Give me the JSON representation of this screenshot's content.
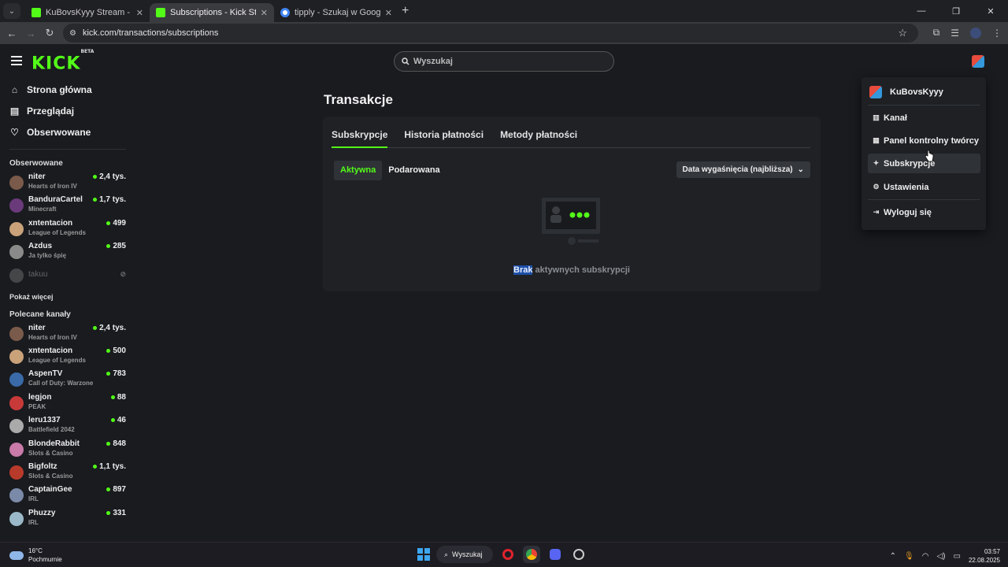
{
  "browser": {
    "tabs": [
      {
        "title": "KuBovsKyyy Stream - Watch Liv",
        "active": false,
        "favicon": "kick"
      },
      {
        "title": "Subscriptions - Kick Streaming",
        "active": true,
        "favicon": "kick"
      },
      {
        "title": "tipply - Szukaj w Google",
        "active": false,
        "favicon": "google"
      }
    ],
    "url": "kick.com/transactions/subscriptions"
  },
  "header": {
    "logo": "KICK",
    "logo_badge": "BETA",
    "search_placeholder": "Wyszukaj"
  },
  "sidebar": {
    "nav": [
      {
        "label": "Strona główna",
        "icon": "home-icon"
      },
      {
        "label": "Przeglądaj",
        "icon": "browse-icon"
      },
      {
        "label": "Obserwowane",
        "icon": "heart-icon"
      }
    ],
    "followed_title": "Obserwowane",
    "followed": [
      {
        "name": "niter",
        "game": "Hearts of Iron IV",
        "viewers": "2,4 tys.",
        "color": "#7a5a4a"
      },
      {
        "name": "BanduraCartel",
        "game": "Minecraft",
        "viewers": "1,7 tys.",
        "color": "#6a3a7a"
      },
      {
        "name": "xntentacion",
        "game": "League of Legends",
        "viewers": "499",
        "color": "#c9a27a"
      },
      {
        "name": "Azdus",
        "game": "Ja tylko śpię",
        "viewers": "285",
        "color": "#8a8a8a"
      }
    ],
    "offline": {
      "name": "takuu"
    },
    "show_more": "Pokaż więcej",
    "recommended_title": "Polecane kanały",
    "recommended": [
      {
        "name": "niter",
        "game": "Hearts of Iron IV",
        "viewers": "2,4 tys.",
        "color": "#7a5a4a"
      },
      {
        "name": "xntentacion",
        "game": "League of Legends",
        "viewers": "500",
        "color": "#c9a27a"
      },
      {
        "name": "AspenTV",
        "game": "Call of Duty: Warzone",
        "viewers": "783",
        "color": "#3a6aa8"
      },
      {
        "name": "legjon",
        "game": "PEAK",
        "viewers": "88",
        "color": "#c83a3a"
      },
      {
        "name": "leru1337",
        "game": "Battlefield 2042",
        "viewers": "46",
        "color": "#aaaaaa"
      },
      {
        "name": "BlondeRabbit",
        "game": "Slots & Casino",
        "viewers": "848",
        "color": "#c87aa8"
      },
      {
        "name": "Bigfoltz",
        "game": "Slots & Casino",
        "viewers": "1,1 tys.",
        "color": "#b83a2a"
      },
      {
        "name": "CaptainGee",
        "game": "IRL",
        "viewers": "897",
        "color": "#7a8aa8"
      },
      {
        "name": "Phuzzy",
        "game": "IRL",
        "viewers": "331",
        "color": "#9ab8c8"
      }
    ]
  },
  "main": {
    "title": "Transakcje",
    "tabs": [
      "Subskrypcje",
      "Historia płatności",
      "Metody płatności"
    ],
    "pills": [
      "Aktywna",
      "Podarowana"
    ],
    "sort_label": "Data wygaśnięcia (najbliższa)",
    "empty_highlight": "Brak",
    "empty_rest": " aktywnych subskrypcji"
  },
  "dropdown": {
    "username": "KuBovsKyyy",
    "items": [
      {
        "label": "Kanał",
        "icon": "channel-icon"
      },
      {
        "label": "Panel kontrolny twórcy",
        "icon": "dashboard-icon"
      },
      {
        "label": "Subskrypcje",
        "icon": "sparkle-icon"
      },
      {
        "label": "Ustawienia",
        "icon": "gear-icon"
      },
      {
        "label": "Wyloguj się",
        "icon": "logout-icon"
      }
    ]
  },
  "taskbar": {
    "temp": "16°C",
    "weather": "Pochmurnie",
    "search": "Wyszukaj",
    "time": "03:57",
    "date": "22.08.2025"
  },
  "colors": {
    "accent": "#53fc18",
    "background": "#191b1f",
    "card": "#1f2125"
  }
}
